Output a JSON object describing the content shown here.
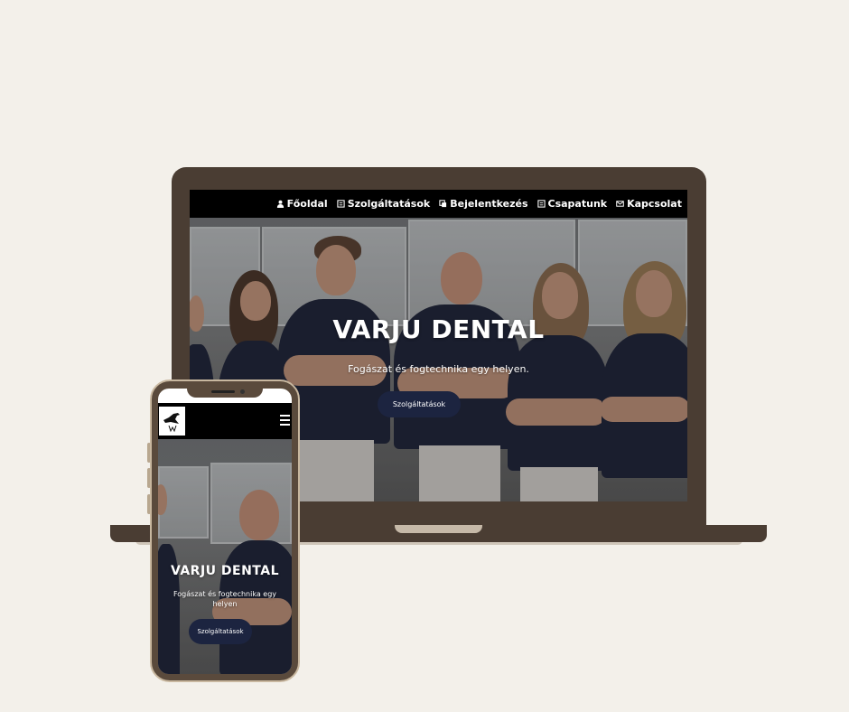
{
  "laptop": {
    "nav": [
      {
        "label": "Főoldal",
        "icon": "user-icon"
      },
      {
        "label": "Szolgáltatások",
        "icon": "document-icon"
      },
      {
        "label": "Bejelentkezés",
        "icon": "copy-icon"
      },
      {
        "label": "Csapatunk",
        "icon": "document-icon"
      },
      {
        "label": "Kapcsolat",
        "icon": "mail-icon"
      }
    ],
    "hero": {
      "title": "VARJU DENTAL",
      "subtitle": "Fogászat és fogtechnika egy helyen.",
      "button": "Szolgáltatások"
    }
  },
  "phone": {
    "hero": {
      "title": "VARJU DENTAL",
      "subtitle": "Fogászat és fogtechnika egy helyen",
      "button": "Szolgáltatások"
    }
  },
  "colors": {
    "background": "#f3f0ea",
    "device_frame": "#4a3d33",
    "button": "#1c2440",
    "uniform": "#1d2236"
  }
}
